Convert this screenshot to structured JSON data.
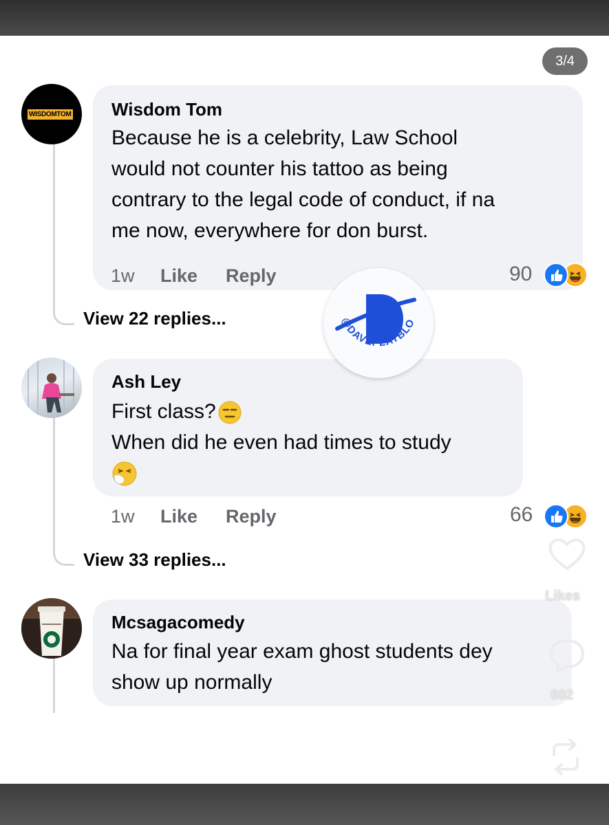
{
  "pager": "3/4",
  "comments": [
    {
      "author": "Wisdom Tom",
      "avatar_text": "WISDOMTOM",
      "lines": [
        "Because he is a celebrity, Law School",
        "would not counter his tattoo as being",
        "contrary to the legal code of conduct, if na",
        "me now, everywhere for don burst."
      ],
      "time": "1w",
      "like": "Like",
      "reply": "Reply",
      "reactions": "90",
      "view_replies": "View 22 replies..."
    },
    {
      "author": "Ash Ley",
      "lines": [
        "First class?",
        "When did he even had times to study"
      ],
      "time": "1w",
      "like": "Like",
      "reply": "Reply",
      "reactions": "66",
      "view_replies": "View 33 replies..."
    },
    {
      "author": "Mcsagacomedy",
      "lines": [
        "Na for final year exam ghost students dey",
        "show up normally"
      ]
    }
  ],
  "side_actions": {
    "likes_label": "Likes",
    "comments_count": "602"
  },
  "watermark": {
    "handle": "@DAVEPLAYBLOGGER"
  },
  "icons": [
    "like-reaction-icon",
    "haha-reaction-icon",
    "expressionless-emoji-icon",
    "sneezing-emoji-icon",
    "heart-outline-icon",
    "comment-bubble-icon",
    "repost-icon"
  ],
  "colors": {
    "like_blue": "#1877f2",
    "haha_yellow": "#f7b125",
    "bubble": "#f0f2f5",
    "text_gray": "#65676b"
  }
}
